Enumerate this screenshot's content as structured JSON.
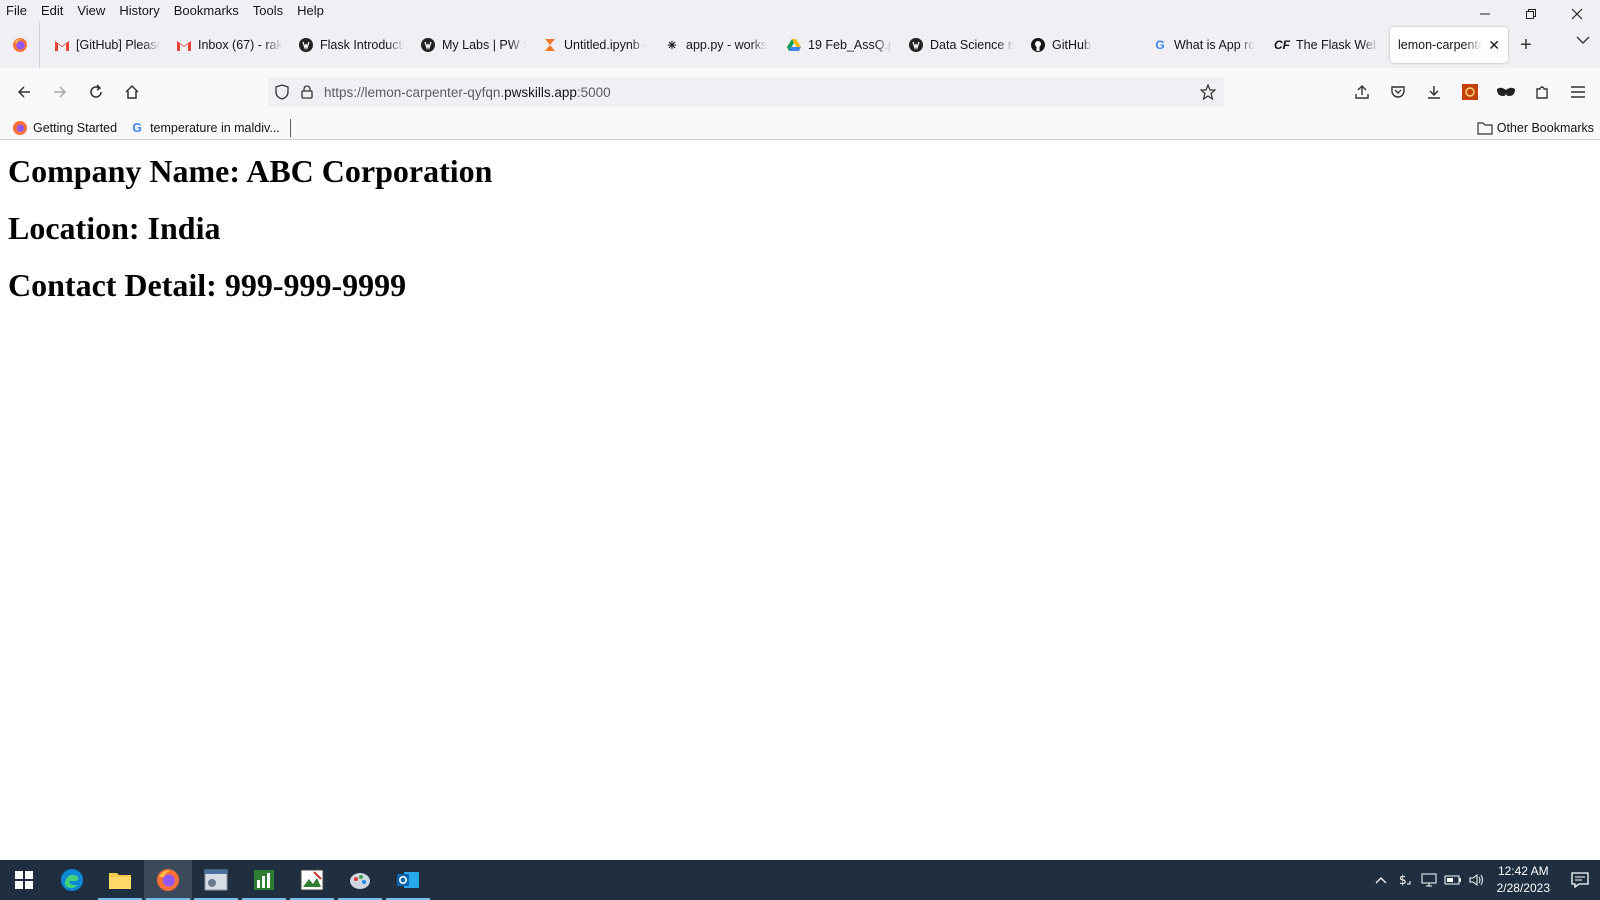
{
  "menubar": {
    "items": [
      "File",
      "Edit",
      "View",
      "History",
      "Bookmarks",
      "Tools",
      "Help"
    ]
  },
  "tabs": [
    {
      "title": "[GitHub] Please",
      "icon": "gmail-icon"
    },
    {
      "title": "Inbox (67) - rak",
      "icon": "gmail-icon"
    },
    {
      "title": "Flask Introducti",
      "icon": "pwskills-icon"
    },
    {
      "title": "My Labs | PW S",
      "icon": "pwskills-icon"
    },
    {
      "title": "Untitled.ipynb -",
      "icon": "jupyter-icon"
    },
    {
      "title": "app.py - works",
      "icon": "code-icon"
    },
    {
      "title": "19 Feb_AssQ.p",
      "icon": "google-drive-icon"
    },
    {
      "title": "Data Science m",
      "icon": "pwskills-icon"
    },
    {
      "title": "GitHub",
      "icon": "github-icon"
    },
    {
      "title": "What is App ro",
      "icon": "google-icon"
    },
    {
      "title": "The Flask Web",
      "icon": "flask-icon"
    }
  ],
  "active_tab": {
    "title": "lemon-carpente",
    "icon": "none"
  },
  "navbar": {
    "url_prefix": "https://lemon-carpenter-qyfqn.",
    "url_host": "pwskills.app",
    "url_suffix": ":5000"
  },
  "bookmarks": {
    "items": [
      {
        "label": "Getting Started",
        "icon": "firefox-icon"
      },
      {
        "label": "temperature in maldiv...",
        "icon": "google-icon"
      }
    ],
    "other": "Other Bookmarks"
  },
  "page": {
    "heading1": "Company Name: ABC Corporation",
    "heading2": "Location: India",
    "heading3": "Contact Detail: 999-999-9999"
  },
  "taskbar": {
    "time": "12:42 AM",
    "date": "2/28/2023"
  },
  "colors": {
    "taskbar_bg": "#1f2f3f",
    "chrome_bg": "#f0f0f4",
    "accent": "#76b9ed"
  }
}
